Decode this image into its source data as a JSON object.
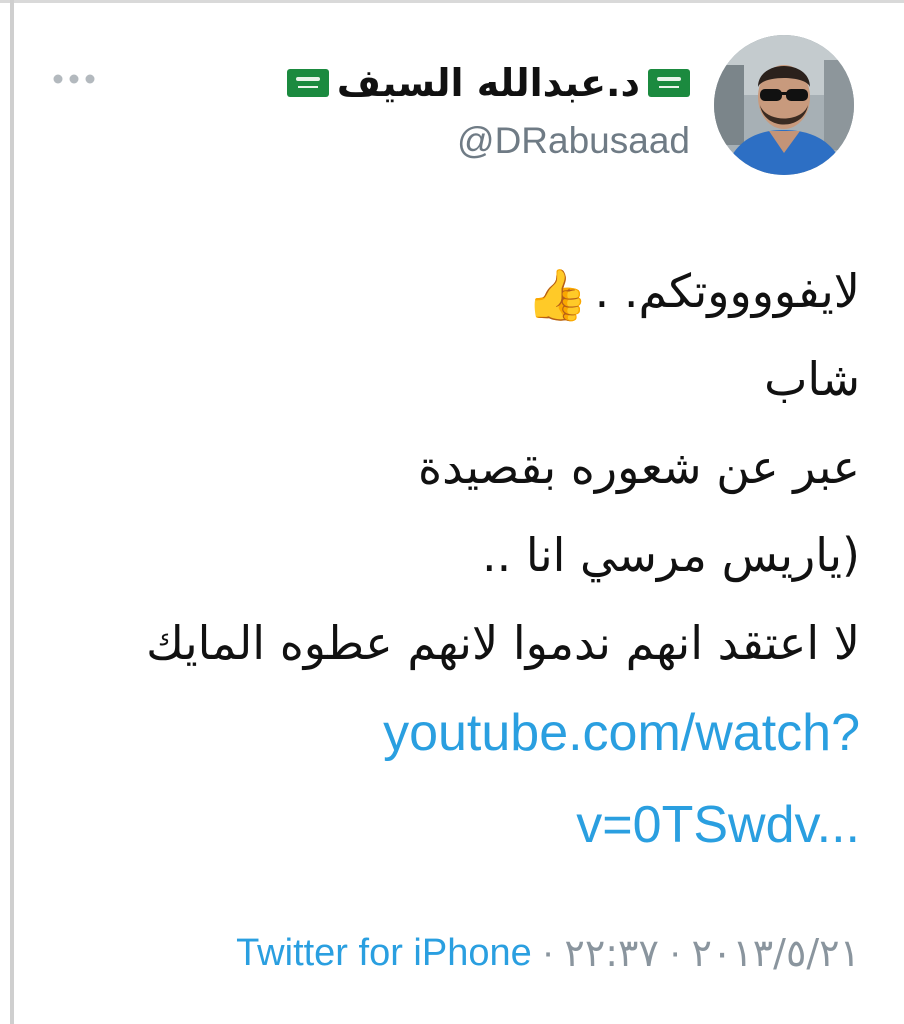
{
  "author": {
    "name": "د.عبدالله السيف",
    "handle": "@DRabusaad",
    "flag_icon": "saudi-flag-icon"
  },
  "tweet": {
    "lines": [
      "لايفووووتكم. .",
      "شاب",
      "عبر عن شعوره بقصيدة",
      "(ياريس مرسي انا ..",
      "لا اعتقد انهم ندموا لانهم عطوه المايك"
    ],
    "emoji": "👍",
    "link_lines": [
      "youtube.com/watch?",
      "v=0TSwdv..."
    ]
  },
  "meta": {
    "source": "Twitter for iPhone",
    "separator": "·",
    "time": "٢٢:٣٧",
    "date": "٢٠١٣/٥/٢١"
  },
  "colors": {
    "link": "#2a9fe0",
    "muted": "#6f7b85",
    "text": "#111111",
    "flag": "#1b8a3f"
  }
}
